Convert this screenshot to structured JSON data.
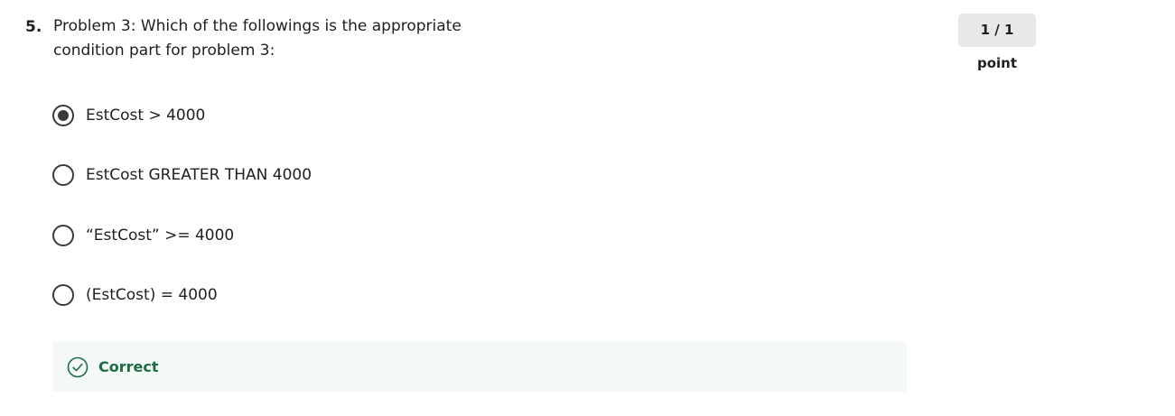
{
  "question": {
    "number": "5.",
    "text_line1": "Problem 3: Which of the followings is the appropriate",
    "text_line2": "condition part for problem 3:",
    "score": "1 / 1 point"
  },
  "options": [
    {
      "label": "EstCost > 4000",
      "selected": true
    },
    {
      "label": "EstCost GREATER THAN 4000",
      "selected": false
    },
    {
      "label": "“EstCost” >= 4000",
      "selected": false
    },
    {
      "label": "(EstCost) = 4000",
      "selected": false
    }
  ],
  "feedback": {
    "label": "Correct",
    "icon": "check-circle-icon",
    "color": "#1d6b45"
  }
}
